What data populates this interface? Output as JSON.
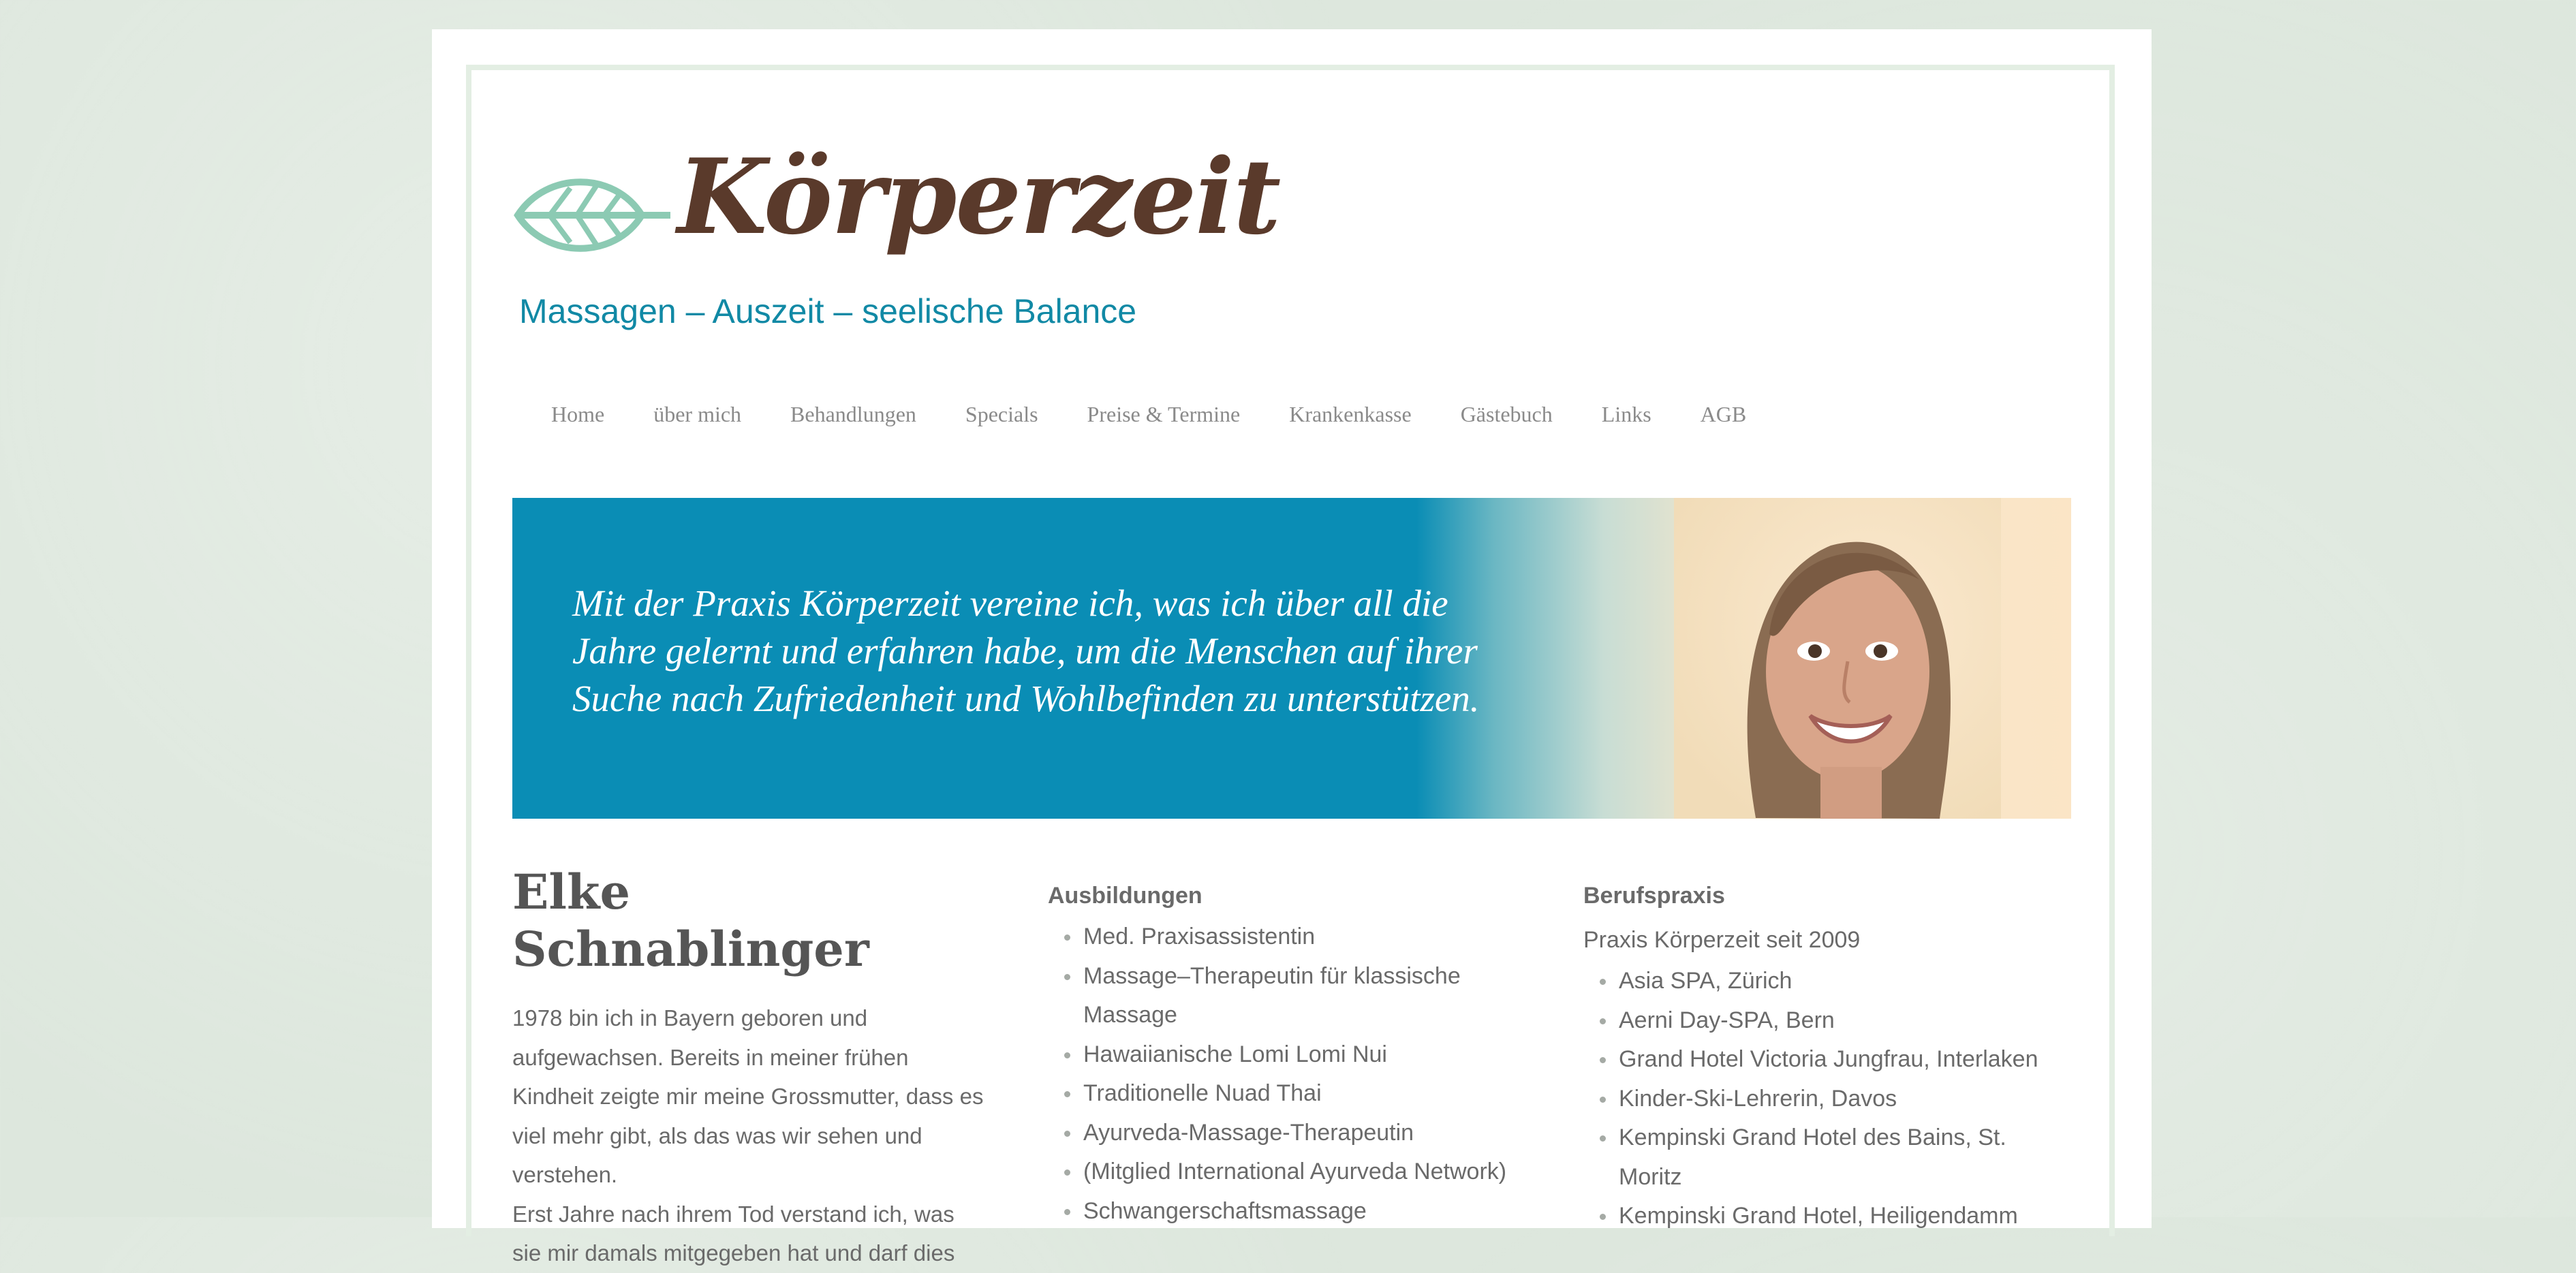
{
  "brand": {
    "logo_word": "Körperzeit",
    "tagline": "Massagen – Auszeit – seelische Balance",
    "colors": {
      "brown": "#5a3a2b",
      "teal": "#1189a5",
      "leaf": "#8ccab3",
      "banner_blue": "#0a8db5"
    }
  },
  "nav": {
    "items": [
      {
        "label": "Home"
      },
      {
        "label": "über mich"
      },
      {
        "label": "Behandlungen"
      },
      {
        "label": "Specials"
      },
      {
        "label": "Preise & Termine"
      },
      {
        "label": "Krankenkasse"
      },
      {
        "label": "Gästebuch"
      },
      {
        "label": "Links"
      },
      {
        "label": "AGB"
      }
    ]
  },
  "banner": {
    "line1": "Mit der Praxis Körperzeit vereine ich, was ich über all die",
    "line2": "Jahre gelernt und erfahren habe, um die Menschen auf ihrer",
    "line3": "Suche nach Zufriedenheit und Wohlbefinden zu unterstützen."
  },
  "profile": {
    "name": "Elke Schnablinger",
    "bio": "1978 bin ich in Bayern geboren und aufgewachsen. Bereits in meiner frühen Kindheit zeigte mir meine Grossmutter, dass es viel mehr gibt, als das was wir sehen und verstehen.",
    "bio2": "Erst Jahre nach ihrem Tod verstand ich, was sie mir damals mitgegeben hat und darf dies"
  },
  "ausbildungen": {
    "heading": "Ausbildungen",
    "items": [
      "Med. Praxisassistentin",
      "Massage–Therapeutin für klassische Massage",
      "Hawaiianische Lomi Lomi Nui",
      "Traditionelle Nuad Thai",
      "Ayurveda-Massage-Therapeutin",
      "(Mitglied International Ayurveda Network)",
      "Schwangerschaftsmassage"
    ]
  },
  "berufspraxis": {
    "heading": "Berufspraxis",
    "intro": "Praxis Körperzeit seit 2009",
    "items": [
      "Asia SPA, Zürich",
      "Aerni Day-SPA, Bern",
      "Grand Hotel Victoria Jungfrau, Interlaken",
      "Kinder-Ski-Lehrerin, Davos",
      "Kempinski Grand Hotel des Bains, St. Moritz",
      "Kempinski Grand Hotel, Heiligendamm"
    ]
  }
}
